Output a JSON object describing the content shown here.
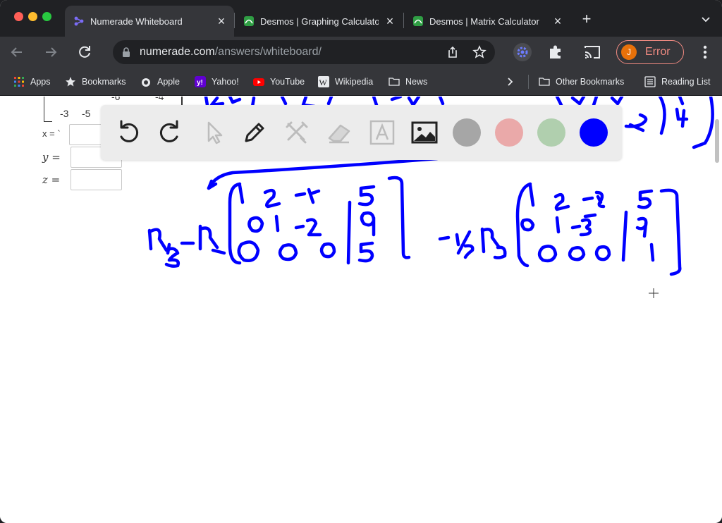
{
  "browser": {
    "tabs": [
      {
        "title": "Numerade Whiteboard",
        "active": true,
        "favicon": "numerade-icon"
      },
      {
        "title": "Desmos | Graphing Calculato",
        "active": false,
        "favicon": "desmos-icon"
      },
      {
        "title": "Desmos | Matrix Calculator",
        "active": false,
        "favicon": "desmos-icon"
      }
    ],
    "address": {
      "host": "numerade.com",
      "path": "/answers/whiteboard/"
    },
    "profile": {
      "initial": "J",
      "status": "Error"
    }
  },
  "bookmarks": {
    "items": [
      {
        "label": "Apps",
        "icon": "apps-grid-icon"
      },
      {
        "label": "Bookmarks",
        "icon": "star-icon"
      },
      {
        "label": "Apple",
        "icon": "apple-icon"
      },
      {
        "label": "Yahoo!",
        "icon": "yahoo-icon"
      },
      {
        "label": "YouTube",
        "icon": "youtube-icon"
      },
      {
        "label": "Wikipedia",
        "icon": "wikipedia-icon"
      },
      {
        "label": "News",
        "icon": "folder-icon"
      }
    ],
    "other": "Other Bookmarks",
    "reading_list": "Reading List"
  },
  "problem": {
    "matrix_row": [
      "-3",
      "-5",
      "-6",
      "-4"
    ],
    "x_label": "x = `",
    "y_label": "y =",
    "z_label": "z ="
  },
  "whiteboard": {
    "tools": [
      "undo-icon",
      "redo-icon",
      "pointer-icon",
      "pen-icon",
      "tools-icon",
      "eraser-icon",
      "text-icon",
      "image-icon"
    ],
    "colors": [
      "#a6a6a6",
      "#eaa9a9",
      "#b0cfae",
      "#0000ff"
    ],
    "selected_color": "#0000ff"
  }
}
